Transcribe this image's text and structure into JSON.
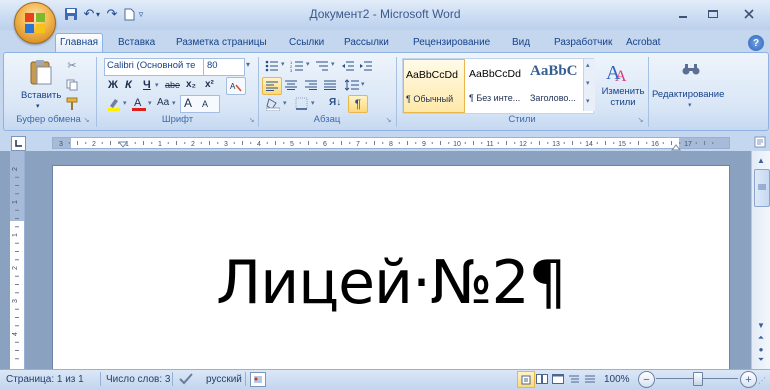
{
  "window": {
    "title": "Документ2 - Microsoft Word",
    "controls": [
      "minimize",
      "maximize",
      "close"
    ]
  },
  "tabs": [
    "Главная",
    "Вставка",
    "Разметка страницы",
    "Ссылки",
    "Рассылки",
    "Рецензирование",
    "Вид",
    "Разработчик",
    "Acrobat"
  ],
  "ribbon": {
    "clipboard": {
      "paste_label": "Вставить",
      "group_label": "Буфер обмена"
    },
    "font": {
      "font_name": "Calibri (Основной те",
      "font_size": "80",
      "bold": "Ж",
      "italic": "К",
      "underline": "Ч",
      "strike": "abe",
      "subscript": "x₂",
      "superscript": "x²",
      "grow": "A",
      "shrink": "A",
      "case": "Aa",
      "group_label": "Шрифт"
    },
    "paragraph": {
      "sort": "Я↓",
      "pilcrow": "¶",
      "group_label": "Абзац"
    },
    "styles": {
      "items": [
        {
          "preview": "AaBbCcDd",
          "name": "¶ Обычный"
        },
        {
          "preview": "AaBbCcDd",
          "name": "¶ Без инте..."
        },
        {
          "preview": "AaBbC",
          "name": "Заголово..."
        }
      ],
      "change_label": "Изменить стили",
      "group_label": "Стили"
    },
    "editing": {
      "label": "Редактирование"
    }
  },
  "ruler": {
    "numbers": [
      "3",
      "2",
      "1",
      "1",
      "2",
      "3",
      "4",
      "5",
      "6",
      "7",
      "8",
      "9",
      "10",
      "11",
      "12",
      "13",
      "14",
      "15",
      "16",
      "17"
    ],
    "vnumbers": [
      "2",
      "1",
      "1",
      "2",
      "3",
      "4"
    ]
  },
  "document": {
    "text": "Лицей·№2¶"
  },
  "status": {
    "page": "Страница: 1 из 1",
    "words": "Число слов: 3",
    "language": "русский",
    "zoom": "100%",
    "zoom_level": 0.5
  }
}
